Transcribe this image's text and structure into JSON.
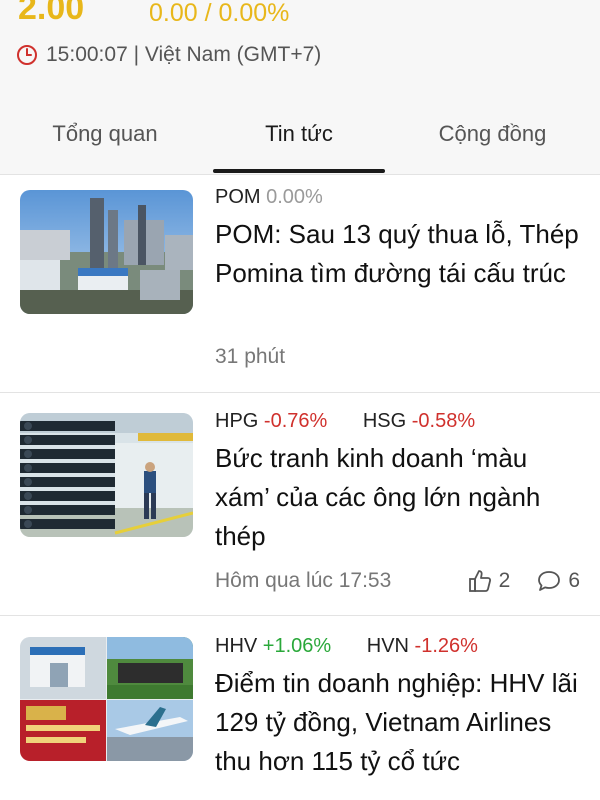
{
  "stock": {
    "price": "2.00",
    "change": "0.00 / 0.00%",
    "time": "15:00:07 | Việt Nam (GMT+7)"
  },
  "tabs": [
    {
      "label": "Tổng quan",
      "active": false
    },
    {
      "label": "Tin tức",
      "active": true
    },
    {
      "label": "Cộng đồng",
      "active": false
    }
  ],
  "articles": [
    {
      "tickers": [
        {
          "symbol": "POM",
          "change": "0.00%",
          "trend": "neutral"
        }
      ],
      "title": "POM: Sau 13 quý thua lỗ, Thép Pomina tìm đường tái cấu trúc",
      "time": "31 phút",
      "image": "steel-plant-photo"
    },
    {
      "tickers": [
        {
          "symbol": "HPG",
          "change": "-0.76%",
          "trend": "negative"
        },
        {
          "symbol": "HSG",
          "change": "-0.58%",
          "trend": "negative"
        }
      ],
      "title": "Bức tranh kinh doanh ‘màu xám’ của các ông lớn ngành thép",
      "time": "Hôm qua lúc 17:53",
      "likes": "2",
      "comments": "6",
      "image": "steel-pipes-warehouse-photo"
    },
    {
      "tickers": [
        {
          "symbol": "HHV",
          "change": "+1.06%",
          "trend": "positive"
        },
        {
          "symbol": "HVN",
          "change": "-1.26%",
          "trend": "negative"
        }
      ],
      "title": "Điểm tin doanh nghiệp: HHV lãi 129 tỷ đồng, Vietnam Airlines thu hơn 115 tỷ cổ tức",
      "image": "business-collage-photo"
    }
  ],
  "colors": {
    "price": "#e8b71a",
    "negative": "#d0312d",
    "positive": "#2aa83a",
    "neutral": "#9a9a9a",
    "clock": "#d0312d"
  }
}
